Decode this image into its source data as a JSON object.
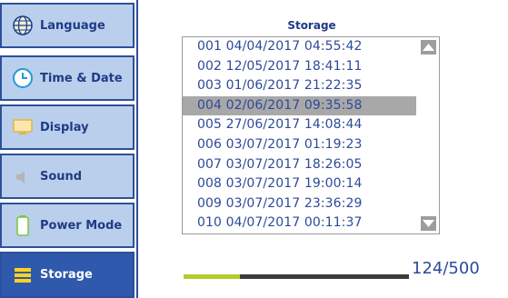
{
  "sidebar": {
    "items": [
      {
        "label": "Language",
        "icon": "globe-icon"
      },
      {
        "label": "Time & Date",
        "icon": "clock-icon"
      },
      {
        "label": "Display",
        "icon": "monitor-icon"
      },
      {
        "label": "Sound",
        "icon": "speaker-icon"
      },
      {
        "label": "Power Mode",
        "icon": "battery-icon"
      },
      {
        "label": "Storage",
        "icon": "storage-icon",
        "active": true
      }
    ]
  },
  "storage": {
    "title": "Storage",
    "entries": [
      "001 04/04/2017 04:55:42",
      "002 12/05/2017 18:41:11",
      "003 01/06/2017 21:22:35",
      "004 02/06/2017 09:35:58",
      "005 27/06/2017 14:08:44",
      "006 03/07/2017 01:19:23",
      "007 03/07/2017 18:26:05",
      "008 03/07/2017 19:00:14",
      "009 03/07/2017 23:36:29",
      "010 04/07/2017 00:11:37"
    ],
    "selected_index": 3,
    "usage_text": "124/500",
    "usage_fraction": 0.248
  },
  "colors": {
    "accent": "#2f59ad",
    "nav_background": "#b9cfec",
    "text": "#2d4a9a",
    "usage_fill": "#b4cc2a",
    "usage_track": "#3c3c3c",
    "selection": "#a8a8a8"
  }
}
